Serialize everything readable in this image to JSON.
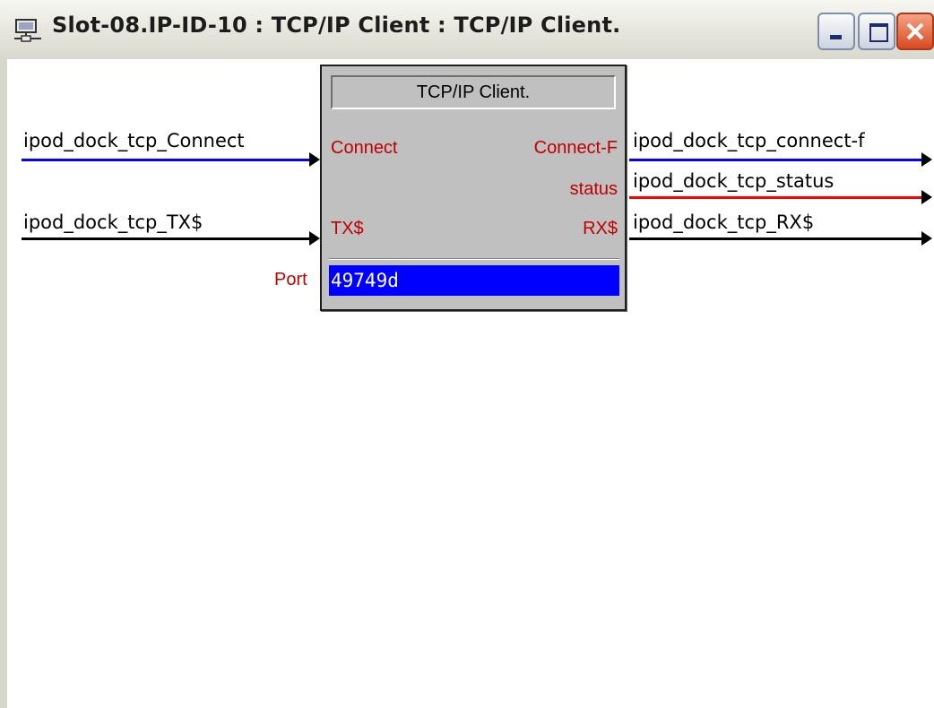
{
  "window": {
    "title": "Slot-08.IP-ID-10 : TCP/IP Client : TCP/IP Client."
  },
  "block": {
    "title": "TCP/IP Client.",
    "inputs": {
      "connect": "Connect",
      "tx": "TX$"
    },
    "outputs": {
      "connect_f": "Connect-F",
      "status": "status",
      "rx": "RX$"
    },
    "param_label": "Port",
    "param_value": "49749d"
  },
  "signals": {
    "in_connect": "ipod_dock_tcp_Connect",
    "in_tx": "ipod_dock_tcp_TX$",
    "out_connect_f": "ipod_dock_tcp_connect-f",
    "out_status": "ipod_dock_tcp_status",
    "out_rx": "ipod_dock_tcp_RX$"
  },
  "colors": {
    "digital_wire": "#0000ff",
    "analog_wire": "#ff0000",
    "serial_wire": "#000000",
    "pin_label": "#c00000",
    "param_bg": "#0000ff"
  }
}
